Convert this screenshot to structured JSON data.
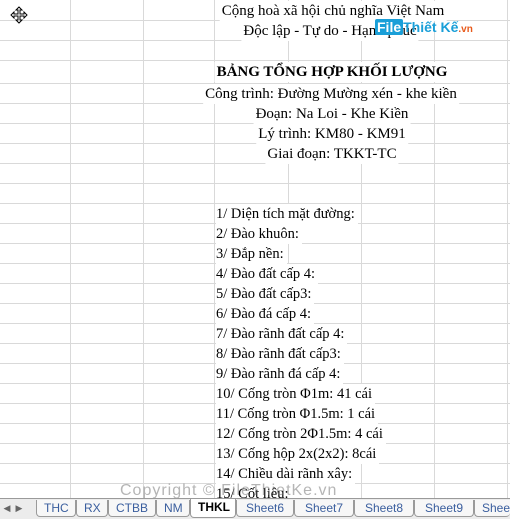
{
  "header": {
    "line1": "Cộng hoà xã hội chủ nghĩa Việt Nam",
    "line2": "Độc lập - Tự do - Hạnh phúc"
  },
  "title": "BẢNG TỔNG HỢP KHỐI LƯỢNG",
  "info": {
    "cong_trinh": "Công trình: Đường Mường xén - khe kiền",
    "doan": "Đoạn: Na Loi - Khe Kiền",
    "ly_trinh": "Lý trình: KM80 - KM91",
    "giai_doan": "Giai đoạn: TKKT-TC"
  },
  "items": [
    "1/ Diện tích mặt đường:",
    "2/ Đào khuôn:",
    "3/ Đắp nền:",
    "4/ Đào đất cấp 4:",
    "5/ Đào đất cấp3:",
    "6/ Đào đá cấp 4:",
    "7/ Đào rãnh đất cấp 4:",
    "8/ Đào rãnh đất cấp3:",
    "9/ Đào rãnh đá cấp 4:",
    "10/ Cống tròn Φ1m: 41 cái",
    "11/ Cống tròn Φ1.5m: 1 cái",
    "12/ Cống tròn 2Φ1.5m: 4 cái",
    "13/ Cống hộp 2x(2x2): 8cái",
    "14/ Chiều dài rãnh xây:",
    "15/ Cốt liệu:"
  ],
  "watermark": {
    "file": "File",
    "thietke": "Thiết Kế",
    "vn": ".vn"
  },
  "copyright": "Copyright © FileThietKe.vn",
  "tabs": [
    "THC",
    "RX",
    "CTBB",
    "NM",
    "THKL",
    "Sheet6",
    "Sheet7",
    "Sheet8",
    "Sheet9",
    "Shee"
  ],
  "active_tab": "THKL",
  "icons": {
    "cursor": "move-cursor-icon",
    "tab_prev": "tab-scroll-left-icon",
    "tab_next": "tab-scroll-right-icon"
  }
}
